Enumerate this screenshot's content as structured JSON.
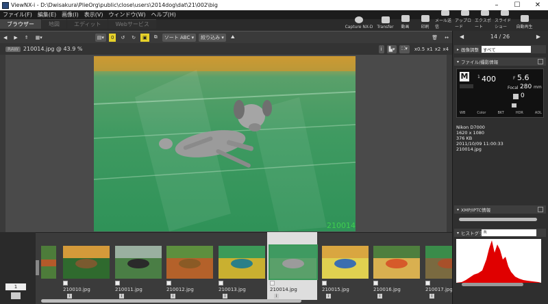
{
  "titlebar": {
    "title": "ViewNX-i - D:\\Dwisakura\\PlieOrg\\public\\close\\users\\2014dog\\dat\\21\\002\\big",
    "min": "–",
    "max": "☐",
    "close": "✕"
  },
  "menu": [
    "ファイル(F)",
    "編集(E)",
    "画像(I)",
    "表示(V)",
    "ウィンドウ(W)",
    "ヘルプ(H)"
  ],
  "modetabs": [
    "ブラウザー",
    "地図",
    "エディット",
    "Webサービス"
  ],
  "toolbar": [
    "Capture NX-D",
    "Transfer",
    "動画",
    "印刷",
    "メール送信",
    "アップロード",
    "エクスポート",
    "スライドショー",
    "自動再生"
  ],
  "viewtools": {
    "sort": "ソート ABC",
    "filter": "絞り込み",
    "zoom_levels": [
      "x0.5",
      "x1",
      "x2",
      "x4"
    ]
  },
  "infobar": {
    "raw": "RAW",
    "file_zoom": "210014.jpg @ 43.9 %"
  },
  "photo_caption": "210014",
  "pager": "14 / 26",
  "adjust": {
    "label": "画像調整",
    "value": "すべて"
  },
  "sections": {
    "file_info": "ファイル/撮影情報",
    "xmp": "XMP/IPTC情報",
    "histogram": "ヒストグラム",
    "hist_channel": "R"
  },
  "lcd": {
    "mode": "M",
    "shutter_num": "1",
    "shutter_den": "400",
    "f_label": "F",
    "f_value": "5.6",
    "focal_label": "Focal",
    "focal_value": "280",
    "focal_unit": "mm",
    "ev": "0",
    "labels": [
      "WB",
      "Color",
      "BKT",
      "HDR",
      "ADL"
    ]
  },
  "exif": [
    "Nikon D7000",
    "1620 x 1080",
    "376 KB",
    "2011/10/09 11:00:33",
    "210014.jpg"
  ],
  "strip_counter": "1",
  "thumbnails": [
    {
      "name": "210010.jpg"
    },
    {
      "name": "210011.jpg"
    },
    {
      "name": "210012.jpg"
    },
    {
      "name": "210013.jpg"
    },
    {
      "name": "210014.jpg"
    },
    {
      "name": "210015.jpg"
    },
    {
      "name": "210016.jpg"
    },
    {
      "name": "210017.jpg"
    }
  ],
  "colors": {
    "accent": "#e6d12a",
    "histogram": "#e00000",
    "panel": "#2f2f2f"
  }
}
